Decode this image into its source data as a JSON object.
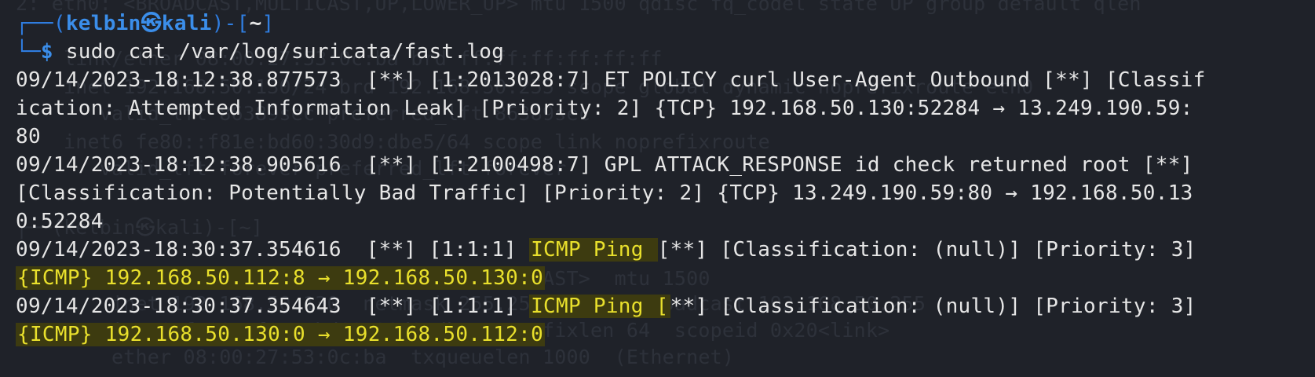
{
  "background_lines": [
    "2: eth0: <BROADCAST,MULTICAST,UP,LOWER_UP> mtu 1500 qdisc fq_codel state UP group default qlen",
    "    link/ether 08:00:27:53:0c:ba brd ff:ff:ff:ff:ff:ff",
    "    inet 192.168.50.130/24 brd 192.168.50.255 scope global dynamic noprefixroute eth0",
    "       valid_lft 86389sec preferred_lft 86389sec",
    "    inet6 fe80::f81e:bd60:30d9:dbe5/64 scope link noprefixroute",
    "       valid_lft forever preferred_lft forever",
    "",
    "┌──(kelbin㉿kali)-[~]",
    "",
    "eth0: flags=4163<UP,BROADCAST,RUNNING,MULTICAST>  mtu 1500",
    "        inet 192.168.50.130  netmask 255.255.255.0  broadcast 192.168.50.255",
    "        inet6 fe80::f81e:bd60:30d9:dbe5  prefixlen 64  scopeid 0x20<link>",
    "        ether 08:00:27:53:0c:ba  txqueuelen 1000  (Ethernet)"
  ],
  "prompt": {
    "frame_top": "┌──(",
    "user": "kelbin",
    "skull": "㉿",
    "host": "kali",
    "frame_mid": ")-[",
    "dir": "~",
    "frame_end": "]",
    "frame_bottom": "└─",
    "dollar": "$",
    "command": " sudo cat /var/log/suricata/fast.log"
  },
  "log": {
    "l1": "09/14/2023-18:12:38.877573  [**] [1:2013028:7] ET POLICY curl User-Agent Outbound [**] [Classif",
    "l2": "ication: Attempted Information Leak] [Priority: 2] {TCP} 192.168.50.130:52284 → 13.249.190.59:",
    "l3": "80",
    "l4": "09/14/2023-18:12:38.905616  [**] [1:2100498:7] GPL ATTACK_RESPONSE id check returned root [**]",
    "l5": "[Classification: Potentially Bad Traffic] [Priority: 2] {TCP} 13.249.190.59:80 → 192.168.50.13",
    "l6": "0:52284",
    "l7_pre": "09/14/2023-18:30:37.354616  [**] [1:1:1] ",
    "l7_hl": "ICMP Ping ",
    "l7_post": "[**] [Classification: (null)] [Priority: 3]",
    "l8_hl": "{ICMP} 192.168.50.112:8 → 192.168.50.130:0",
    "l9_pre": "09/14/2023-18:30:37.354643  [**] [1:1:1] ",
    "l9_hl": "ICMP Ping [",
    "l9_post": "**] [Classification: (null)] [Priority: 3]",
    "l10_hl": "{ICMP} 192.168.50.130:0 → 192.168.50.112:0"
  },
  "colors": {
    "background": "#1f2229",
    "text": "#e6e6e6",
    "prompt_blue": "#3b8eea",
    "highlight_text": "#e9e02c",
    "highlight_bg": "#3d3b10"
  }
}
